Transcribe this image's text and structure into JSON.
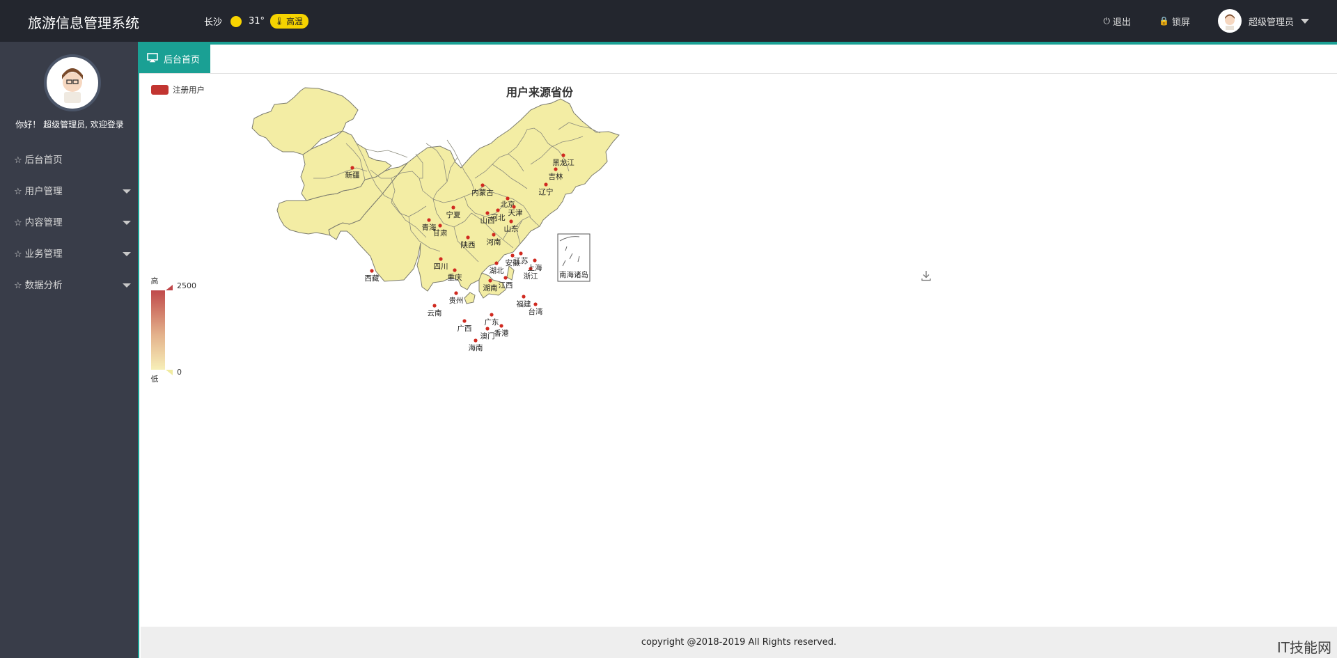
{
  "header": {
    "title": "旅游信息管理系统",
    "city": "长沙",
    "temperature": "31°",
    "weather_badge": "高温",
    "logout": "退出",
    "lock": "锁屏",
    "username": "超级管理员"
  },
  "sidebar": {
    "welcome": "你好！ 超级管理员, 欢迎登录",
    "items": [
      {
        "label": "后台首页",
        "has_submenu": false
      },
      {
        "label": "用户管理",
        "has_submenu": true
      },
      {
        "label": "内容管理",
        "has_submenu": true
      },
      {
        "label": "业务管理",
        "has_submenu": true
      },
      {
        "label": "数据分析",
        "has_submenu": true
      }
    ]
  },
  "tabs": [
    {
      "label": "后台首页"
    }
  ],
  "chart_data": {
    "type": "map",
    "title": "用户来源省份",
    "legend": [
      "注册用户"
    ],
    "series_name": "注册用户",
    "visual_map": {
      "min": 0,
      "max": 2500,
      "text_high": "高",
      "text_low": "低"
    },
    "inset_label": "南海诸岛",
    "regions": [
      "新疆",
      "西藏",
      "内蒙古",
      "青海",
      "四川",
      "黑龙江",
      "甘肃",
      "云南",
      "广西",
      "湖南",
      "陕西",
      "广东",
      "吉林",
      "河北",
      "湖北",
      "贵州",
      "山东",
      "江西",
      "河南",
      "辽宁",
      "山西",
      "安徽",
      "福建",
      "浙江",
      "江苏",
      "重庆",
      "宁夏",
      "海南",
      "台湾",
      "北京",
      "天津",
      "上海",
      "香港",
      "澳门"
    ],
    "colors": {
      "land": "#f3eda4",
      "border": "#7b7b6e",
      "marker": "#d02a20",
      "legend": "#c23531"
    }
  },
  "footer": "copyright @2018-2019 All Rights reserved.",
  "watermark": "IT技能网"
}
